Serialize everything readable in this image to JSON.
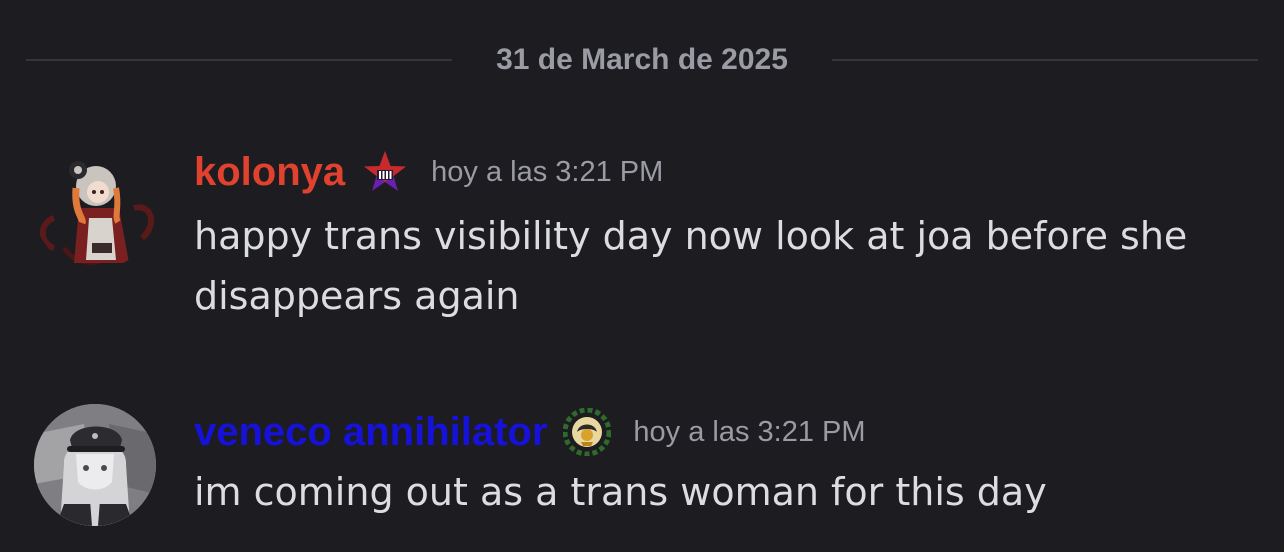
{
  "divider": {
    "date": "31 de March de 2025"
  },
  "messages": [
    {
      "username": "kolonya",
      "username_color": "#e0422f",
      "badge_icon": "purple-star-badge-icon",
      "timestamp": "hoy a las 3:21 PM",
      "avatar_icon": "anime-character-avatar",
      "text": "happy trans visibility day now look at joa before she\ndisappears again"
    },
    {
      "username": "veneco annihilator",
      "username_color": "#1612d9",
      "badge_icon": "laurel-wreath-emblem-badge-icon",
      "timestamp": "hoy a las 3:21 PM",
      "avatar_icon": "grayscale-anime-avatar",
      "text": "im coming out as a trans woman for this day"
    }
  ],
  "colors": {
    "background": "#1c1c21",
    "divider_line": "#35363c",
    "muted_text": "#9a9ba3",
    "message_text": "#dcdde1"
  }
}
